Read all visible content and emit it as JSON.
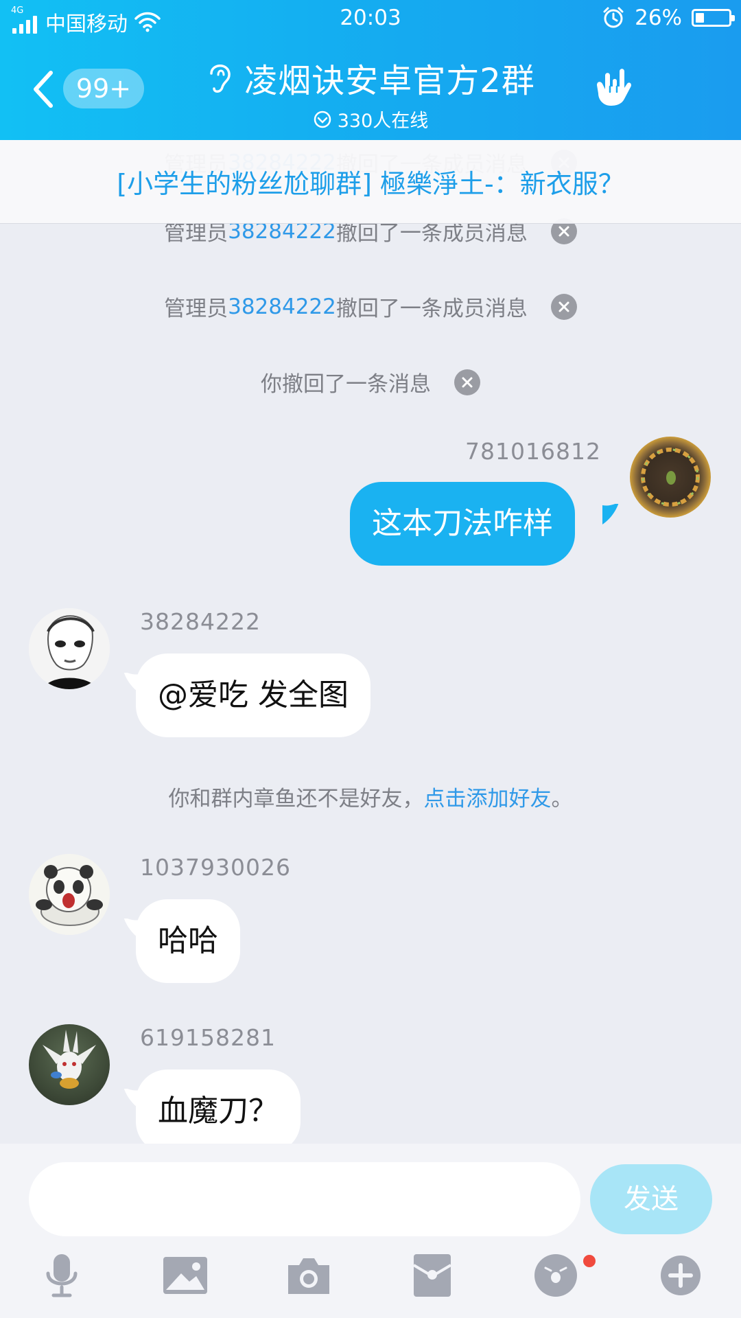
{
  "status_bar": {
    "network": "4G",
    "carrier": "中国移动",
    "time": "20:03",
    "battery_percent": "26%",
    "battery_level": 0.26
  },
  "header": {
    "unread_count": "99+",
    "title": "凌烟诀安卓官方2群",
    "online": "330人在线",
    "accent_color": "#15aaf0"
  },
  "notice": {
    "text": "[小学生的粉丝尬聊群] 極樂淨土-：新衣服？"
  },
  "system_messages": [
    {
      "prefix": "管理员",
      "id": "38284222",
      "suffix": "撤回了一条成员消息"
    },
    {
      "prefix": "管理员",
      "id": "38284222",
      "suffix": "撤回了一条成员消息"
    },
    {
      "text": "你撤回了一条消息"
    }
  ],
  "messages": [
    {
      "sender": "781016812",
      "text": "这本刀法咋样",
      "direction": "out"
    },
    {
      "sender": "38284222",
      "text": "@爱吃 发全图",
      "direction": "in"
    },
    {
      "sender": "1037930026",
      "text": "哈哈",
      "direction": "in"
    },
    {
      "sender": "619158281",
      "text": "血魔刀？",
      "direction": "in"
    }
  ],
  "friend_tip": {
    "text": "你和群内章鱼还不是好友，",
    "link": "点击添加好友",
    "end": "。"
  },
  "input": {
    "value": "",
    "send_label": "发送"
  },
  "toolbar": [
    "microphone-icon",
    "image-icon",
    "camera-icon",
    "red-packet-icon",
    "emoji-icon",
    "plus-icon"
  ]
}
